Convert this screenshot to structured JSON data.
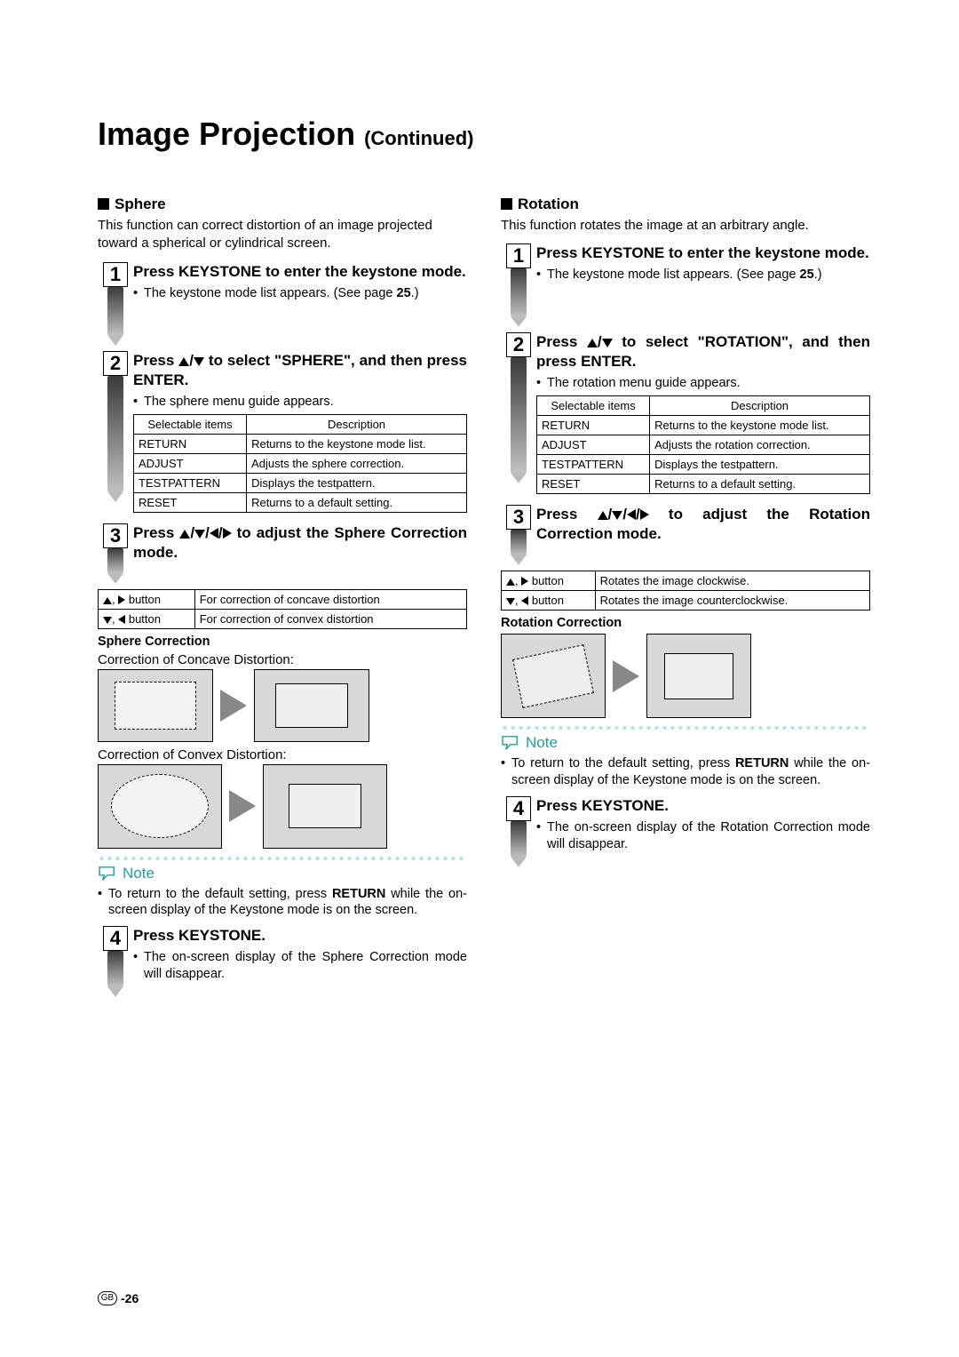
{
  "title_main": "Image Projection",
  "title_sub": "(Continued)",
  "sphere": {
    "heading": "Sphere",
    "intro": "This function can correct distortion of an image projected toward a spherical or cylindrical screen.",
    "step1_a": "Press ",
    "step1_b": "KEYSTONE",
    "step1_c": " to enter the keystone mode.",
    "step1_bullet": "The keystone mode list appears. (See page ",
    "step1_page": "25",
    "step1_end": ".)",
    "step2_a": "Press ",
    "step2_b": " to select \"SPHERE\", and then press ",
    "step2_c": "ENTER",
    "step2_d": ".",
    "step2_bullet": "The sphere menu guide appears.",
    "table_headers": [
      "Selectable items",
      "Description"
    ],
    "table_rows": [
      [
        "RETURN",
        "Returns to the keystone mode list."
      ],
      [
        "ADJUST",
        "Adjusts the sphere correction."
      ],
      [
        "TESTPATTERN",
        "Displays the testpattern."
      ],
      [
        "RESET",
        "Returns to a default setting."
      ]
    ],
    "step3_a": "Press ",
    "step3_b": " to adjust the Sphere Correction mode.",
    "adj_rows": [
      [
        ", ",
        " button",
        "For correction of concave distortion"
      ],
      [
        ", ",
        " button",
        "For correction of convex distortion"
      ]
    ],
    "corr_head": "Sphere Correction",
    "cap_concave": "Correction of Concave Distortion:",
    "cap_convex": "Correction of Convex Distortion:",
    "note_label": "Note",
    "note_text_a": "To return to the default setting, press ",
    "note_text_b": "RETURN",
    "note_text_c": " while the on-screen display of the Keystone mode is on the screen.",
    "step4_a": "Press ",
    "step4_b": "KEYSTONE",
    "step4_c": ".",
    "step4_bullet": "The on-screen display of the Sphere Correction mode will disappear."
  },
  "rotation": {
    "heading": "Rotation",
    "intro": "This function rotates the image at an arbitrary angle.",
    "step1_a": "Press ",
    "step1_b": "KEYSTONE",
    "step1_c": " to enter the keystone mode.",
    "step1_bullet": "The keystone mode list appears. (See page ",
    "step1_page": "25",
    "step1_end": ".)",
    "step2_a": "Press ",
    "step2_b": " to select \"ROTATION\", and then press ",
    "step2_c": "ENTER",
    "step2_d": ".",
    "step2_bullet": "The rotation menu guide appears.",
    "table_headers": [
      "Selectable items",
      "Description"
    ],
    "table_rows": [
      [
        "RETURN",
        "Returns to the keystone mode list."
      ],
      [
        "ADJUST",
        "Adjusts the rotation correction."
      ],
      [
        "TESTPATTERN",
        "Displays the testpattern."
      ],
      [
        "RESET",
        "Returns to a default setting."
      ]
    ],
    "step3_a": "Press ",
    "step3_b": " to adjust the Rotation Correction mode.",
    "adj_rows": [
      [
        ", ",
        " button",
        "Rotates the image clockwise."
      ],
      [
        ", ",
        " button",
        "Rotates the image counterclockwise."
      ]
    ],
    "corr_head": "Rotation Correction",
    "note_label": "Note",
    "note_text_a": "To return to the default setting, press ",
    "note_text_b": "RETURN",
    "note_text_c": " while the on-screen display of the Keystone mode is on the screen.",
    "step4_a": "Press ",
    "step4_b": "KEYSTONE",
    "step4_c": ".",
    "step4_bullet": "The on-screen display of the Rotation Correction mode will disappear."
  },
  "page_num": "-26",
  "gb": "GB"
}
